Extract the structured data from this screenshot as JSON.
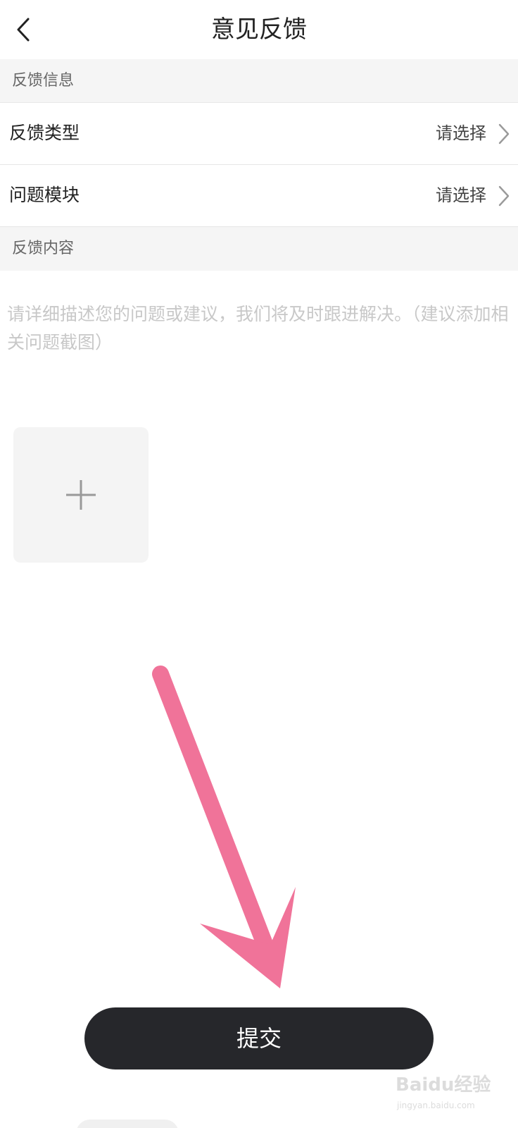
{
  "nav": {
    "title": "意见反馈",
    "back_icon": "chevron-left-icon"
  },
  "sections": {
    "info_header": "反馈信息",
    "content_header": "反馈内容"
  },
  "rows": [
    {
      "label": "反馈类型",
      "value": "请选择",
      "icon": "chevron-right-icon"
    },
    {
      "label": "问题模块",
      "value": "请选择",
      "icon": "chevron-right-icon"
    }
  ],
  "feedback": {
    "placeholder": "请详细描述您的问题或建议，我们将及时跟进解决。（建议添加相关问题截图）"
  },
  "upload": {
    "icon": "plus-icon"
  },
  "submit": {
    "label": "提交"
  },
  "watermark": {
    "logo": "Baidu经验",
    "url": "jingyan.baidu.com"
  },
  "colors": {
    "background": "#ffffff",
    "section_bg": "#f5f5f5",
    "button_bg": "#26272b",
    "annotation_arrow": "#f07399",
    "placeholder_text": "#c8c8c8"
  }
}
